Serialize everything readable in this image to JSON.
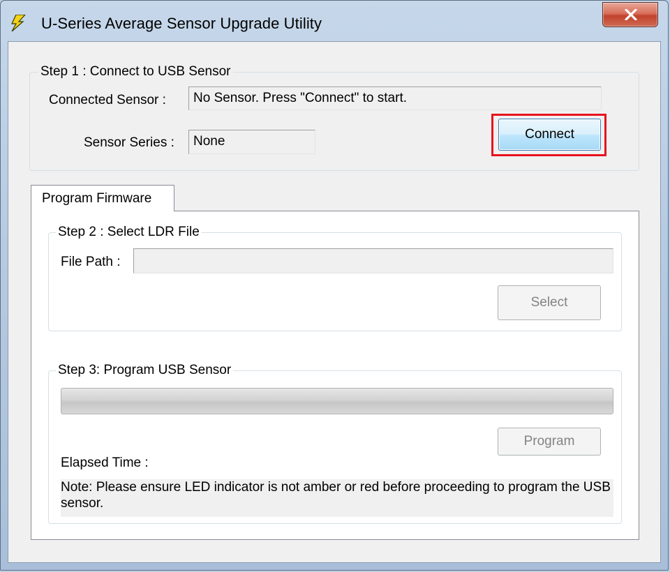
{
  "window": {
    "title": "U-Series Average Sensor Upgrade Utility",
    "close_glyph": "X",
    "app_icon": "lightning-bolt-icon"
  },
  "step1": {
    "legend": "Step 1 : Connect to USB Sensor",
    "connected_sensor_label": "Connected Sensor :",
    "connected_sensor_value": "No Sensor. Press \"Connect\" to start.",
    "sensor_series_label": "Sensor Series :",
    "sensor_series_value": "None",
    "connect_button": "Connect"
  },
  "tabs": [
    {
      "label": "Program Firmware",
      "selected": true
    }
  ],
  "step2": {
    "legend": "Step 2 : Select LDR File",
    "file_path_label": "File Path :",
    "file_path_value": "",
    "select_button": "Select"
  },
  "step3": {
    "legend": "Step 3: Program USB Sensor",
    "progress": 0,
    "program_button": "Program",
    "elapsed_label": "Elapsed Time :",
    "note": "Note: Please ensure LED indicator is not amber or red before proceeding to program the USB sensor."
  },
  "colors": {
    "highlight": "#e8121d",
    "close_button": "#c1422d",
    "title_bar": "#b9cde3"
  }
}
